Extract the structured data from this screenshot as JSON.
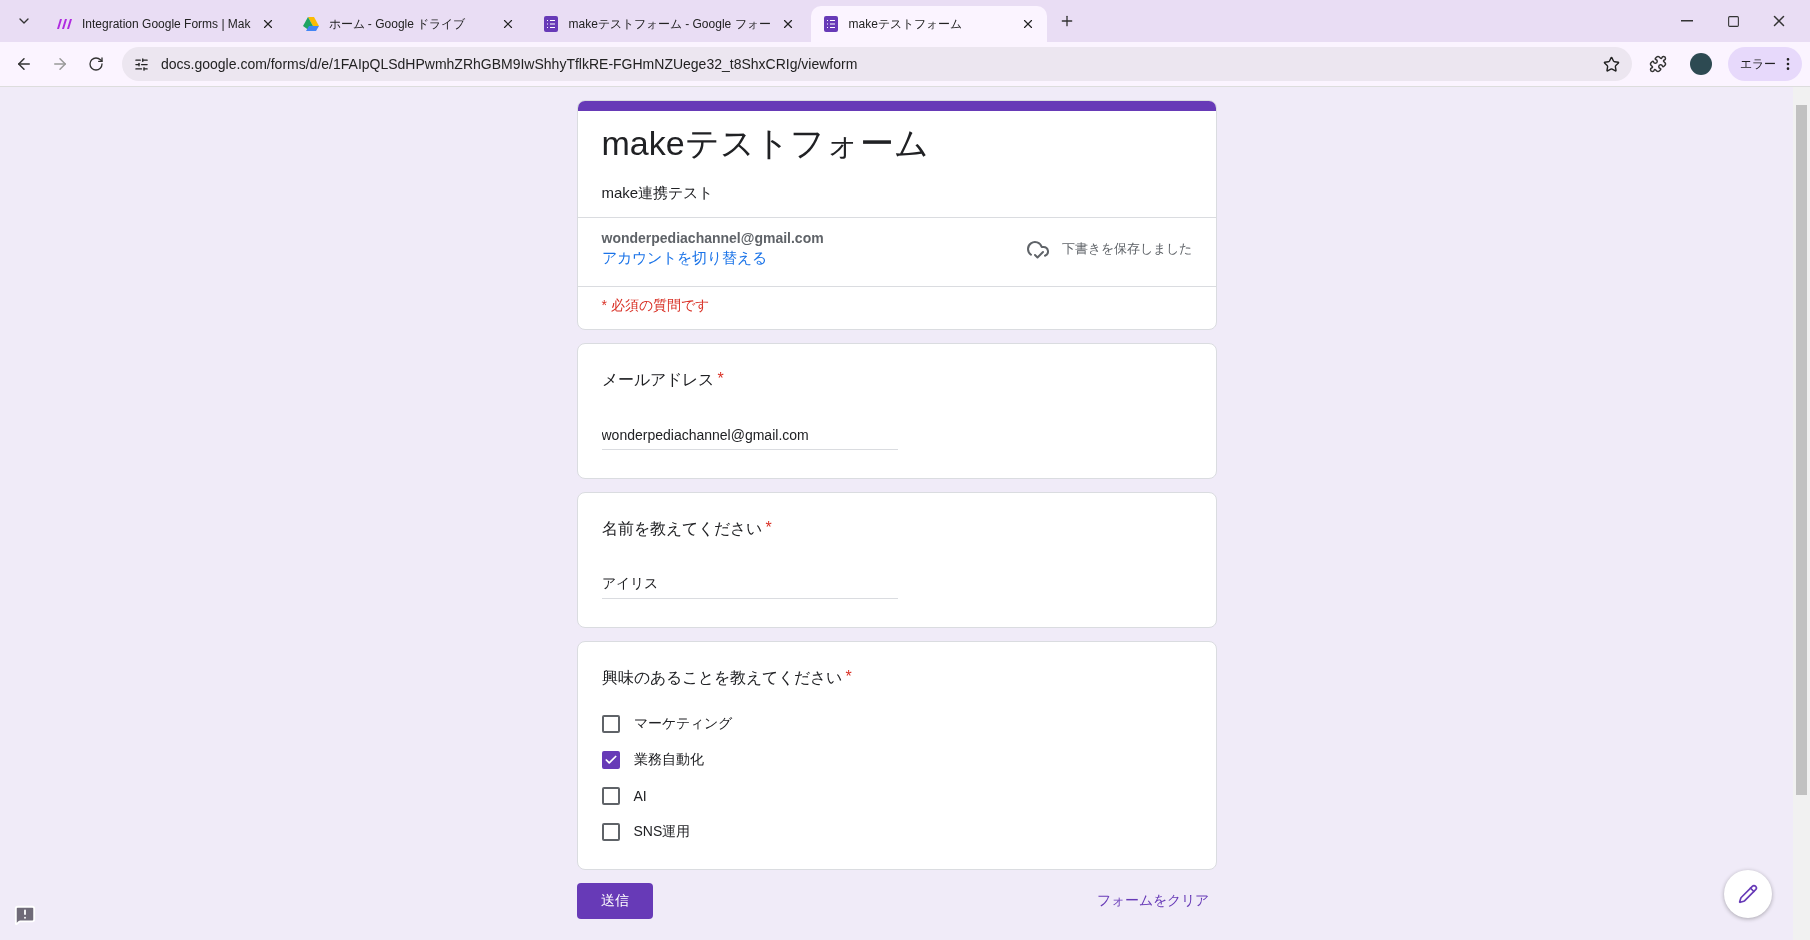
{
  "browser": {
    "tabs": [
      {
        "kind": "make",
        "title": "Integration Google Forms | Mak",
        "selected": false
      },
      {
        "kind": "drive",
        "title": "ホーム - Google ドライブ",
        "selected": false
      },
      {
        "kind": "forms",
        "title": "makeテストフォーム - Google フォー",
        "selected": false
      },
      {
        "kind": "forms",
        "title": "makeテストフォーム",
        "selected": true
      }
    ],
    "address": "docs.google.com/forms/d/e/1FAIpQLSdHPwmhZRhGBM9IwShhyTflkRE-FGHmNZUege32_t8ShxCRIg/viewform",
    "profile_button": "エラー"
  },
  "form": {
    "title": "makeテストフォーム",
    "description": "make連携テスト",
    "account_email": "wonderpediachannel@gmail.com",
    "switch_account": "アカウントを切り替える",
    "save_status": "下書きを保存しました",
    "required_note": "* 必須の質問です",
    "required_mark": "*"
  },
  "questions": [
    {
      "kind": "text",
      "label": "メールアドレス",
      "required": true,
      "value": "wonderpediachannel@gmail.com"
    },
    {
      "kind": "text",
      "label": "名前を教えてください",
      "required": true,
      "value": "アイリス"
    },
    {
      "kind": "checkbox",
      "label": "興味のあることを教えてください",
      "required": true,
      "options": [
        {
          "label": "マーケティング",
          "checked": false
        },
        {
          "label": "業務自動化",
          "checked": true
        },
        {
          "label": "AI",
          "checked": false
        },
        {
          "label": "SNS運用",
          "checked": false
        }
      ]
    }
  ],
  "submit": "送信",
  "clear": "フォームをクリア"
}
